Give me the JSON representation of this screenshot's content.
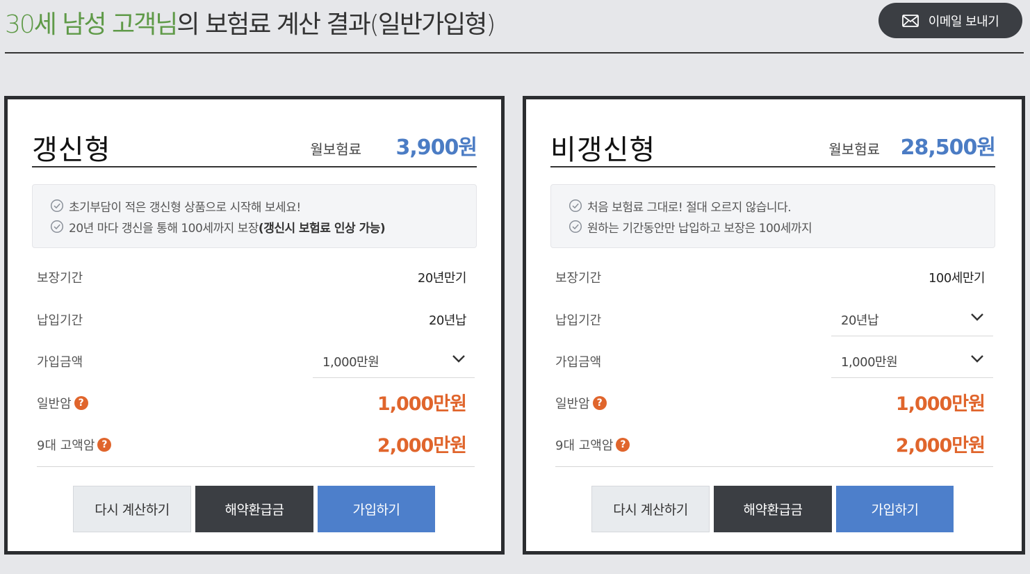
{
  "header": {
    "title_highlight": "30세 남성 고객님",
    "title_rest": "의 보험료 계산 결과(일반가입형)",
    "email_button": "이메일 보내기"
  },
  "colors": {
    "highlight_green": "#5f9a48",
    "premium_blue": "#4b7cc4",
    "coverage_orange": "#e0652c",
    "dark_button": "#3b3e43",
    "primary_button": "#4d7fcb"
  },
  "plans": [
    {
      "title": "갱신형",
      "premium_label": "월보험료",
      "premium_value": "3,900원",
      "info": [
        {
          "text": "초기부담이 적은 갱신형 상품으로 시작해 보세요!",
          "bold": ""
        },
        {
          "text": "20년 마다 갱신을 통해 100세까지 보장",
          "bold": "(갱신시 보험료 인상 가능)"
        }
      ],
      "rows": {
        "coverage_period": {
          "label": "보장기간",
          "value": "20년만기"
        },
        "payment_period": {
          "label": "납입기간",
          "value": "20년납"
        },
        "amount": {
          "label": "가입금액",
          "value": "1,000만원"
        },
        "general_cancer": {
          "label": "일반암",
          "value": "1,000만원"
        },
        "major_cancer": {
          "label": "9대 고액암",
          "value": "2,000만원"
        }
      },
      "buttons": {
        "recalc": "다시 계산하기",
        "refund": "해약환급금",
        "join": "가입하기"
      }
    },
    {
      "title": "비갱신형",
      "premium_label": "월보험료",
      "premium_value": "28,500원",
      "info": [
        {
          "text": "처음 보험료 그대로! 절대 오르지 않습니다.",
          "bold": ""
        },
        {
          "text": "원하는 기간동안만 납입하고 보장은 100세까지",
          "bold": ""
        }
      ],
      "rows": {
        "coverage_period": {
          "label": "보장기간",
          "value": "100세만기"
        },
        "payment_period": {
          "label": "납입기간",
          "value": "20년납"
        },
        "amount": {
          "label": "가입금액",
          "value": "1,000만원"
        },
        "general_cancer": {
          "label": "일반암",
          "value": "1,000만원"
        },
        "major_cancer": {
          "label": "9대 고액암",
          "value": "2,000만원"
        }
      },
      "buttons": {
        "recalc": "다시 계산하기",
        "refund": "해약환급금",
        "join": "가입하기"
      }
    }
  ],
  "icons": {
    "email": "envelope-icon",
    "check": "check-circle-icon",
    "help": "question-circle-icon",
    "dropdown": "chevron-down-icon"
  },
  "help_glyph": "?"
}
